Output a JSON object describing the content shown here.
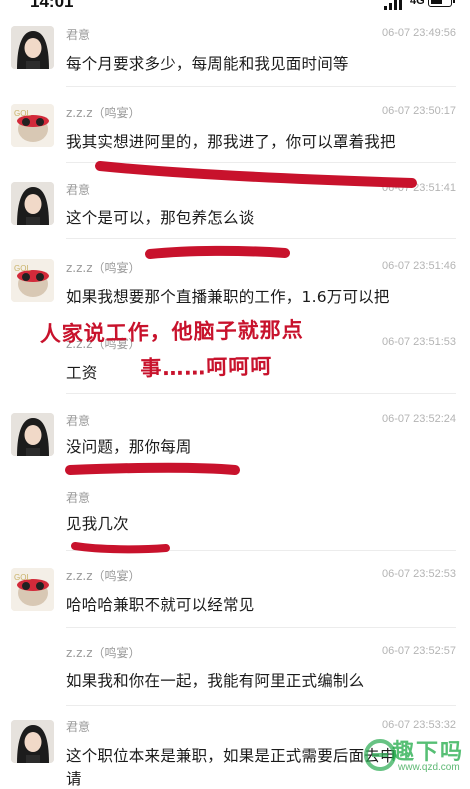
{
  "status_bar": {
    "time": "14:01",
    "network": "4G"
  },
  "messages": [
    {
      "sender": "君意",
      "time": "06-07 23:49:56",
      "text": "每个月要求多少，每周能和我见面时间等"
    },
    {
      "sender": "z.z.z（鸣宴）",
      "time": "06-07 23:50:17",
      "text": "我其实想进阿里的，那我进了，你可以罩着我把"
    },
    {
      "sender": "君意",
      "time": "06-07 23:51:41",
      "text": "这个是可以，那包养怎么谈"
    },
    {
      "sender": "z.z.z（鸣宴）",
      "time": "06-07 23:51:46",
      "text": "如果我想要那个直播兼职的工作，1.6万可以把"
    },
    {
      "sender": "z.z.z（鸣宴）",
      "time": "06-07 23:51:53",
      "text": "工资"
    },
    {
      "sender": "君意",
      "time": "06-07 23:52:24",
      "text": "没问题，那你每周"
    },
    {
      "sender": "君意",
      "time": "",
      "text": "见我几次"
    },
    {
      "sender": "z.z.z（鸣宴）",
      "time": "06-07 23:52:53",
      "text": "哈哈哈兼职不就可以经常见"
    },
    {
      "sender": "z.z.z（鸣宴）",
      "time": "06-07 23:52:57",
      "text": "如果我和你在一起，我能有阿里正式编制么"
    },
    {
      "sender": "君意",
      "time": "06-07 23:53:32",
      "text": "这个职位本来是兼职，如果是正式需要后面去申",
      "text2": "请"
    }
  ],
  "annotation": {
    "line1": "人家说工作，他脑子就那点",
    "line2": "事……呵呵呵",
    "color": "#c8122c"
  },
  "watermark": {
    "text": "趣下吗",
    "url": "www.qzd.com"
  }
}
